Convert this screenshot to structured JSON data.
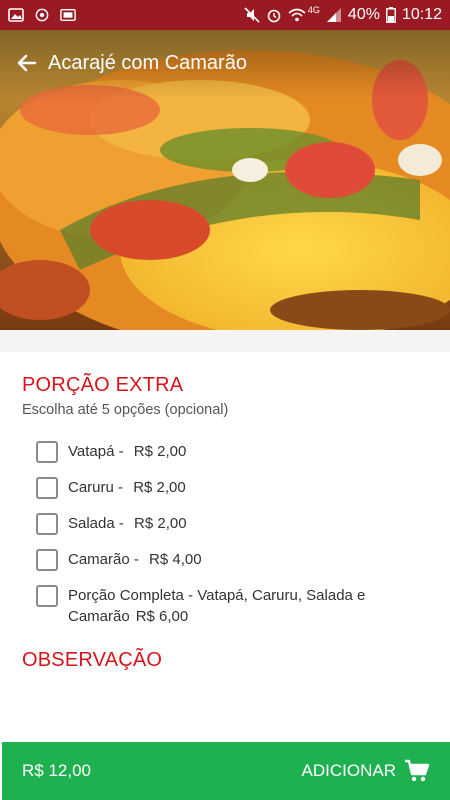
{
  "status_bar": {
    "network_label": "4G",
    "battery_percent": "40%",
    "time": "10:12"
  },
  "toolbar": {
    "title": "Acarajé com Camarão"
  },
  "extra_portion": {
    "title": "PORÇÃO EXTRA",
    "subtitle": "Escolha até 5 opções (opcional)",
    "options": [
      {
        "label": "Vatapá - ",
        "price": "R$ 2,00",
        "checked": false
      },
      {
        "label": "Caruru - ",
        "price": "R$ 2,00",
        "checked": false
      },
      {
        "label": "Salada - ",
        "price": "R$ 2,00",
        "checked": false
      },
      {
        "label": "Camarão - ",
        "price": "R$ 4,00",
        "checked": false
      },
      {
        "label": "Porção Completa - Vatapá, Caruru, Salada e Camarão",
        "price": "R$ 6,00",
        "checked": false
      }
    ]
  },
  "observation": {
    "title": "OBSERVAÇÃO"
  },
  "footer": {
    "total": "R$ 12,00",
    "add_label": "ADICIONAR"
  },
  "colors": {
    "status_bar": "#9a1a24",
    "accent_red": "#d7141e",
    "action_green": "#1fb050"
  }
}
